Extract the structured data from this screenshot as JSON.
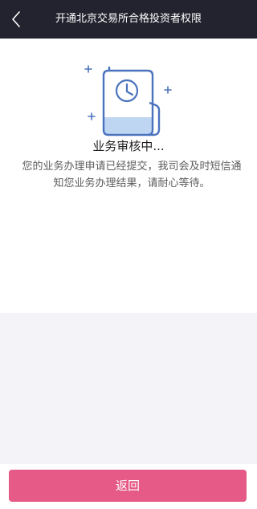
{
  "nav": {
    "back_icon": "chevron-left-icon",
    "title": "开通北京交易所合格投资者权限"
  },
  "main": {
    "illustration_icon": "document-clock-icon",
    "status_text": "业务审核中...",
    "description": "您的业务办理申请已经提交，我司会及时短信通知您业务办理结果，请耐心等待。"
  },
  "footer": {
    "return_label": "返回"
  },
  "colors": {
    "nav_bg": "#23232f",
    "accent_blue": "#4a73bd",
    "fill_blue": "#bfd6f2",
    "button": "#e55a86"
  }
}
